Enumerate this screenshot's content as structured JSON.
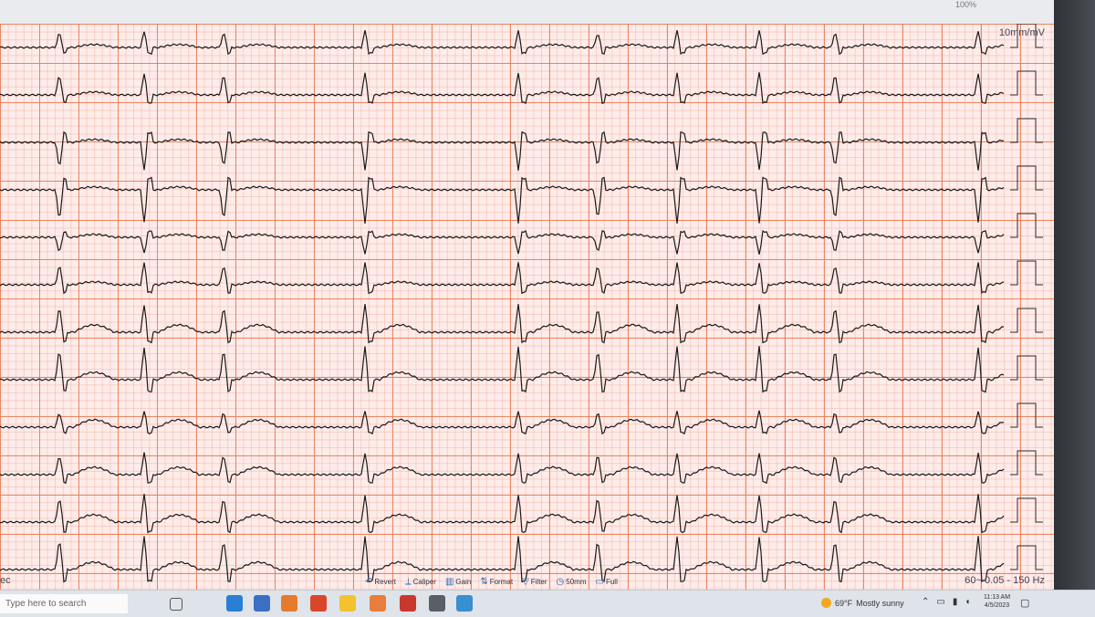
{
  "monitor": {
    "zoom_text": "100%"
  },
  "ecg": {
    "scale_label": "10mm/mV",
    "filter_label": "60~ 0.05 - 150 Hz",
    "sec_label": "ec",
    "lead_count": 12
  },
  "toolbar": {
    "items": [
      {
        "label": "Revert",
        "icon": "revert-icon"
      },
      {
        "label": "Caliper",
        "icon": "caliper-icon"
      },
      {
        "label": "Gain",
        "icon": "gain-icon"
      },
      {
        "label": "Format",
        "icon": "format-icon"
      },
      {
        "label": "Filter",
        "icon": "filter-icon"
      },
      {
        "label": "50mm",
        "icon": "speed-icon"
      },
      {
        "label": "Full",
        "icon": "monitor-icon"
      }
    ]
  },
  "taskbar": {
    "search_placeholder": "Type here to search",
    "weather_temp": "69°F",
    "weather_text": "Mostly sunny",
    "time": "11:13 AM",
    "date": "4/5/2023"
  },
  "colors": {
    "grid_major": "#e87850",
    "grid_minor": "#f0aa96",
    "paper": "#fdecea",
    "trace": "#1a1a1a"
  }
}
